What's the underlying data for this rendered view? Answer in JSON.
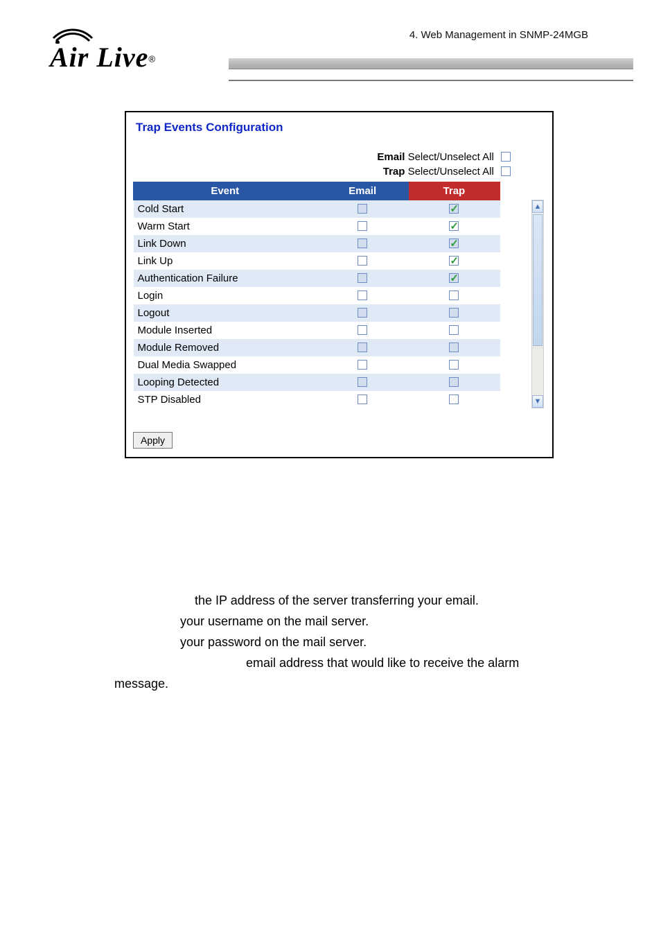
{
  "header": {
    "breadcrumb": "4.  Web Management in SNMP-24MGB",
    "logo_text": "Air Live",
    "logo_reg": "®"
  },
  "panel": {
    "title": "Trap Events Configuration",
    "select_all": {
      "email_label_bold": "Email",
      "email_label_rest": " Select/Unselect All",
      "trap_label_bold": "Trap",
      "trap_label_rest": " Select/Unselect All"
    },
    "columns": {
      "event": "Event",
      "email": "Email",
      "trap": "Trap"
    },
    "rows": [
      {
        "event": "Cold Start",
        "email": false,
        "trap": true
      },
      {
        "event": "Warm Start",
        "email": false,
        "trap": true
      },
      {
        "event": "Link Down",
        "email": false,
        "trap": true
      },
      {
        "event": "Link Up",
        "email": false,
        "trap": true
      },
      {
        "event": "Authentication Failure",
        "email": false,
        "trap": true
      },
      {
        "event": "Login",
        "email": false,
        "trap": false
      },
      {
        "event": "Logout",
        "email": false,
        "trap": false
      },
      {
        "event": "Module Inserted",
        "email": false,
        "trap": false
      },
      {
        "event": "Module Removed",
        "email": false,
        "trap": false
      },
      {
        "event": "Dual Media Swapped",
        "email": false,
        "trap": false
      },
      {
        "event": "Looping Detected",
        "email": false,
        "trap": false
      },
      {
        "event": "STP Disabled",
        "email": false,
        "trap": false
      }
    ],
    "apply_label": "Apply"
  },
  "body_text": {
    "l1": "the IP address of the server transferring your email.",
    "l2": "your username on the mail server.",
    "l3": "your password on the mail server.",
    "l4": "email address that would like to receive the alarm",
    "l5": "message."
  }
}
